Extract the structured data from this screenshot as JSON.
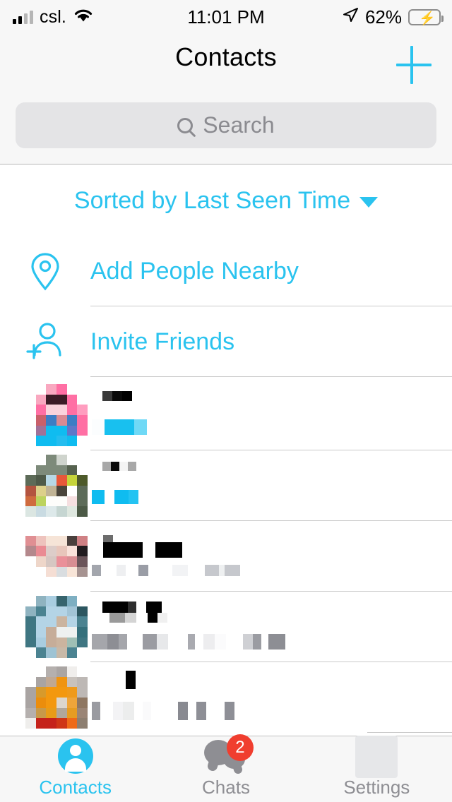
{
  "status_bar": {
    "carrier": "csl.",
    "time": "11:01 PM",
    "battery_percent": "62%",
    "signal_icon": "signal-bars-icon",
    "wifi_icon": "wifi-icon",
    "location_icon": "location-arrow-icon",
    "battery_icon": "battery-charging-icon",
    "battery_level": 62,
    "charging": true
  },
  "header": {
    "title": "Contacts",
    "add_button_label": "+",
    "search": {
      "placeholder": "Search",
      "value": "",
      "icon": "search-icon"
    }
  },
  "sort": {
    "label": "Sorted by Last Seen Time",
    "caret_icon": "chevron-down-icon"
  },
  "actions": [
    {
      "label": "Add People Nearby",
      "icon": "location-pin-icon"
    },
    {
      "label": "Invite Friends",
      "icon": "person-add-icon"
    }
  ],
  "contacts": [
    {
      "name": "",
      "status": "",
      "status_state": "online",
      "avatar_alt": "contact-avatar-1"
    },
    {
      "name": "",
      "status": "",
      "status_state": "online",
      "avatar_alt": "contact-avatar-2"
    },
    {
      "name": "",
      "status": "",
      "status_state": "offline",
      "avatar_alt": "contact-avatar-3"
    },
    {
      "name": "",
      "status": "",
      "status_state": "offline",
      "avatar_alt": "contact-avatar-4"
    },
    {
      "name": "",
      "status": "",
      "status_state": "offline",
      "avatar_alt": "contact-avatar-5"
    }
  ],
  "tabs": [
    {
      "label": "Contacts",
      "icon": "person-icon",
      "active": true,
      "badge": ""
    },
    {
      "label": "Chats",
      "icon": "chats-icon",
      "active": false,
      "badge": "2"
    },
    {
      "label": "Settings",
      "icon": "settings-placeholder-icon",
      "active": false,
      "badge": ""
    }
  ],
  "colors": {
    "accent": "#2ac3ef",
    "badge": "#f03e2f",
    "muted_text": "#8e8e93",
    "chrome_bg": "#f7f7f7",
    "search_bg": "#e4e4e6",
    "separator": "#c9c9c9",
    "battery_green": "#2fd058"
  }
}
